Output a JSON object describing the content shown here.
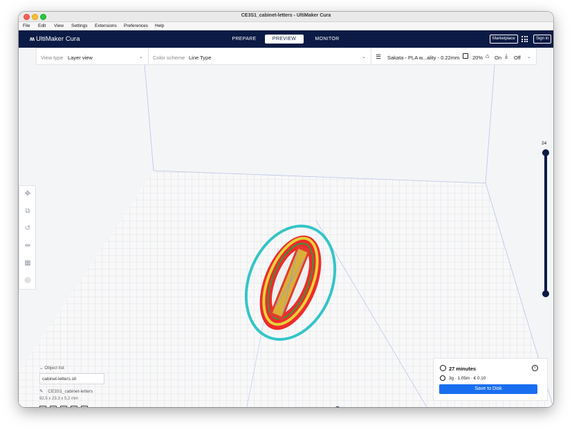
{
  "window": {
    "title": "CE3S1_cabinet-letters - UltiMaker Cura"
  },
  "menubar": {
    "items": [
      "File",
      "Edit",
      "View",
      "Settings",
      "Extensions",
      "Preferences",
      "Help"
    ]
  },
  "header": {
    "logo": "UltiMaker Cura",
    "tabs": [
      {
        "label": "PREPARE",
        "active": false
      },
      {
        "label": "PREVIEW",
        "active": true
      },
      {
        "label": "MONITOR",
        "active": false
      }
    ],
    "marketplace_label": "Marketplace",
    "signin_label": "Sign in",
    "colors": {
      "navy": "#0b1b45",
      "accent_blue": "#196ef0"
    }
  },
  "selectbar": {
    "view_type_label": "View type",
    "view_type_value": "Layer view",
    "color_scheme_label": "Color scheme",
    "color_scheme_value": "Line Type",
    "profile_value": "Sakata - PLA w...ality - 0.22mm",
    "infill_value": "20%",
    "support_value": "On",
    "adhesion_value": "Off"
  },
  "left_toolbar": {
    "icons": [
      "move-icon",
      "scale-icon",
      "rotate-icon",
      "mirror-icon",
      "per-model-settings-icon",
      "support-blocker-icon"
    ]
  },
  "layer_slider": {
    "current_layer": "24"
  },
  "object_list": {
    "header": "Object list",
    "file_name": "cabinet-letters.stl",
    "object_name": "CE3S1_cabinet-letters",
    "dimensions": "92.5 x 23.3 x 5.2 mm"
  },
  "print_info": {
    "time": "27 minutes",
    "material": "3g · 1.05m · € 0.10",
    "save_label": "Save to Disk"
  }
}
